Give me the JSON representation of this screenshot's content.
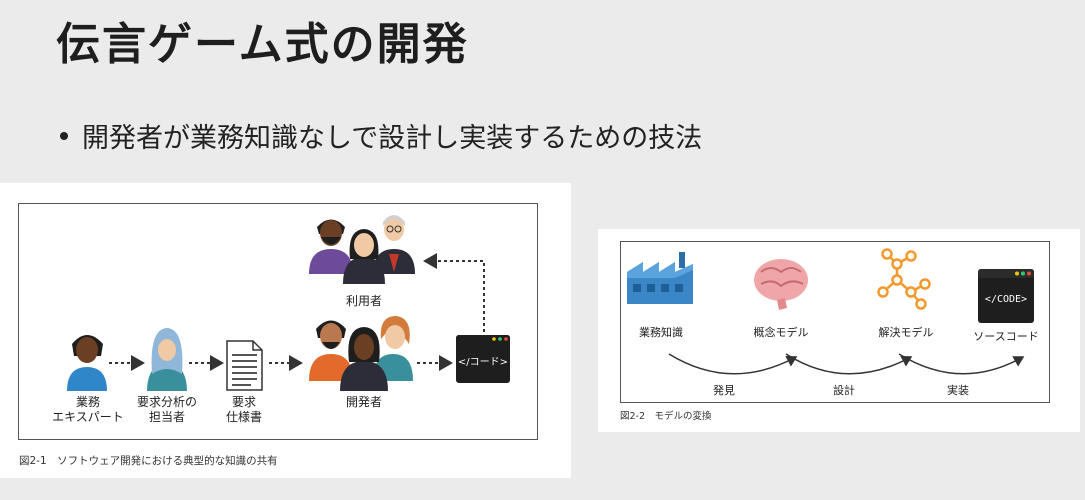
{
  "title": "伝言ゲーム式の開発",
  "bullet": "開発者が業務知識なしで設計し実装するための技法",
  "figure1": {
    "caption": "図2-1　ソフトウェア開発における典型的な知識の共有",
    "expert_label_line1": "業務",
    "expert_label_line2": "エキスパート",
    "analyst_label_line1": "要求分析の",
    "analyst_label_line2": "担当者",
    "spec_label_line1": "要求",
    "spec_label_line2": "仕様書",
    "developers_label": "開発者",
    "users_label": "利用者",
    "code_label": "</コード>"
  },
  "figure2": {
    "caption": "図2-2　モデルの変換",
    "business_knowledge_label": "業務知識",
    "concept_model_label": "概念モデル",
    "solution_model_label": "解決モデル",
    "source_code_label": "ソースコード",
    "code_tag": "</CODE>",
    "step_discover": "発見",
    "step_design": "設計",
    "step_implement": "実装"
  },
  "colors": {
    "skin_dark": "#6b3f24",
    "skin_medium": "#b9784e",
    "skin_light": "#f0c9a5",
    "shirt_blue": "#2f86c8",
    "shirt_teal": "#3a8f9c",
    "shirt_purple": "#6d4b9a",
    "shirt_orange": "#e46a2c",
    "shirt_dark": "#2d2d3a",
    "hijab_blue": "#8fb7d9",
    "factory_blue": "#3b86c6",
    "brain_pink": "#f0a6a8",
    "network_orange": "#f39a2e"
  }
}
